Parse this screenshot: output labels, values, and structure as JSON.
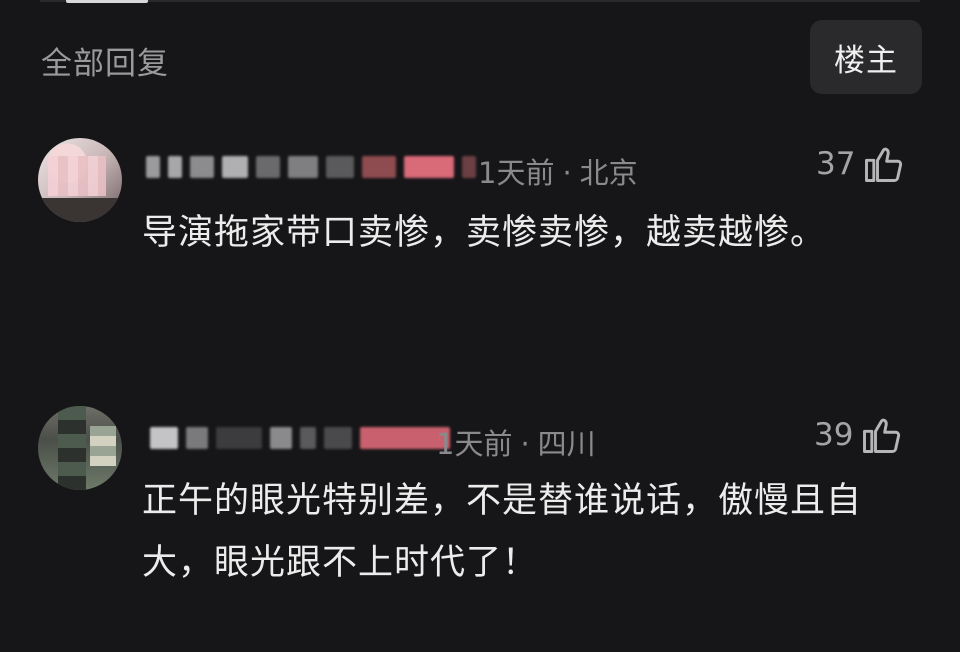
{
  "header": {
    "title": "全部回复",
    "op_button_label": "楼主"
  },
  "comments": [
    {
      "time": "1天前",
      "location": "北京",
      "likes": "37",
      "text": "导演拖家带口卖惨，卖惨卖惨，越卖越惨。"
    },
    {
      "time": "1天前",
      "location": "四川",
      "likes": "39",
      "text": "正午的眼光特别差，不是替谁说话，傲慢且自大，眼光跟不上时代了！"
    }
  ],
  "icons": {
    "like": "thumbs-up-icon"
  },
  "colors": {
    "background": "#161618",
    "text_primary": "#ececec",
    "text_secondary": "#8a8a8c",
    "button_bg": "#2a2a2d"
  }
}
